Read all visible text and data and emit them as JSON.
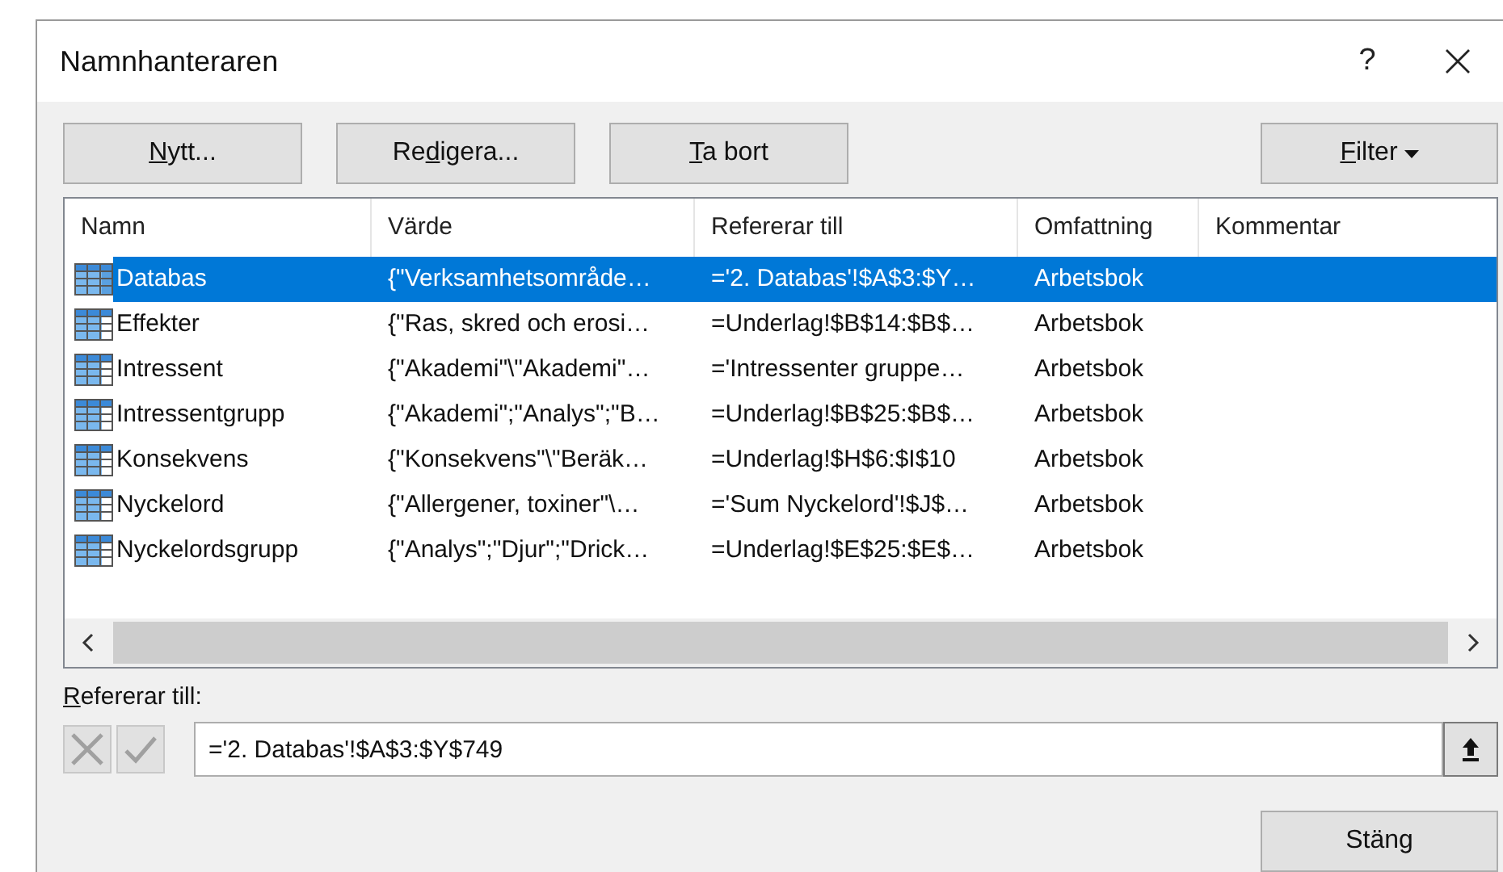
{
  "window": {
    "title": "Namnhanteraren",
    "help": "?"
  },
  "buttons": [
    {
      "key": "N",
      "post": "ytt..."
    },
    {
      "pre": "Re",
      "key": "d",
      "post": "igera..."
    },
    {
      "key": "T",
      "post": "a bort"
    }
  ],
  "filter_button": {
    "key": "F",
    "post": "ilter"
  },
  "table": {
    "columns": [
      "Namn",
      "Värde",
      "Refererar till",
      "Omfattning",
      "Kommentar"
    ],
    "rows": [
      {
        "name": "Databas",
        "value": "{\"Verksamhetsområde…",
        "refers_to": "='2. Databas'!$A$3:$Y…",
        "scope": "Arbetsbok",
        "selected": true
      },
      {
        "name": "Effekter",
        "value": "{\"Ras, skred och erosi…",
        "refers_to": "=Underlag!$B$14:$B$…",
        "scope": "Arbetsbok",
        "selected": false
      },
      {
        "name": "Intressent",
        "value": "{\"Akademi\"\\\"Akademi\"…",
        "refers_to": "='Intressenter gruppe…",
        "scope": "Arbetsbok",
        "selected": false
      },
      {
        "name": "Intressentgrupp",
        "value": "{\"Akademi\";\"Analys\";\"B…",
        "refers_to": "=Underlag!$B$25:$B$…",
        "scope": "Arbetsbok",
        "selected": false
      },
      {
        "name": "Konsekvens",
        "value": "{\"Konsekvens\"\\\"Beräk…",
        "refers_to": "=Underlag!$H$6:$I$10",
        "scope": "Arbetsbok",
        "selected": false
      },
      {
        "name": "Nyckelord",
        "value": "{\"Allergener, toxiner\"\\…",
        "refers_to": "='Sum Nyckelord'!$J$…",
        "scope": "Arbetsbok",
        "selected": false
      },
      {
        "name": "Nyckelordsgrupp",
        "value": "{\"Analys\";\"Djur\";\"Drick…",
        "refers_to": "=Underlag!$E$25:$E$…",
        "scope": "Arbetsbok",
        "selected": false
      }
    ]
  },
  "refers_label": {
    "key": "R",
    "post": "efererar till:"
  },
  "refers_field": {
    "value": "='2. Databas'!$A$3:$Y$749"
  },
  "close_button": "Stäng"
}
